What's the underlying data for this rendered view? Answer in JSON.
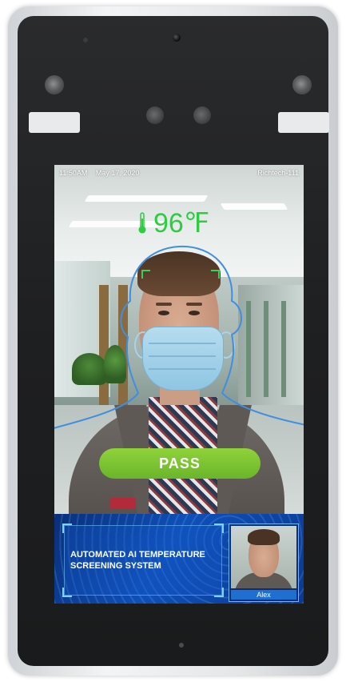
{
  "screen": {
    "status_bar": {
      "time": "11:50AM",
      "date": "May 17, 2020",
      "device_id": "Richtech-111"
    },
    "temperature": {
      "value": "96",
      "unit": "℉",
      "icon": "thermometer-icon",
      "color": "#2ecc40"
    },
    "result": {
      "label": "PASS",
      "color": "#7dc432"
    },
    "banner": {
      "title": "AUTOMATED AI TEMPERATURE SCREENING SYSTEM",
      "color": "#0f4fb8"
    },
    "identified_person": {
      "name": "Alex"
    }
  }
}
